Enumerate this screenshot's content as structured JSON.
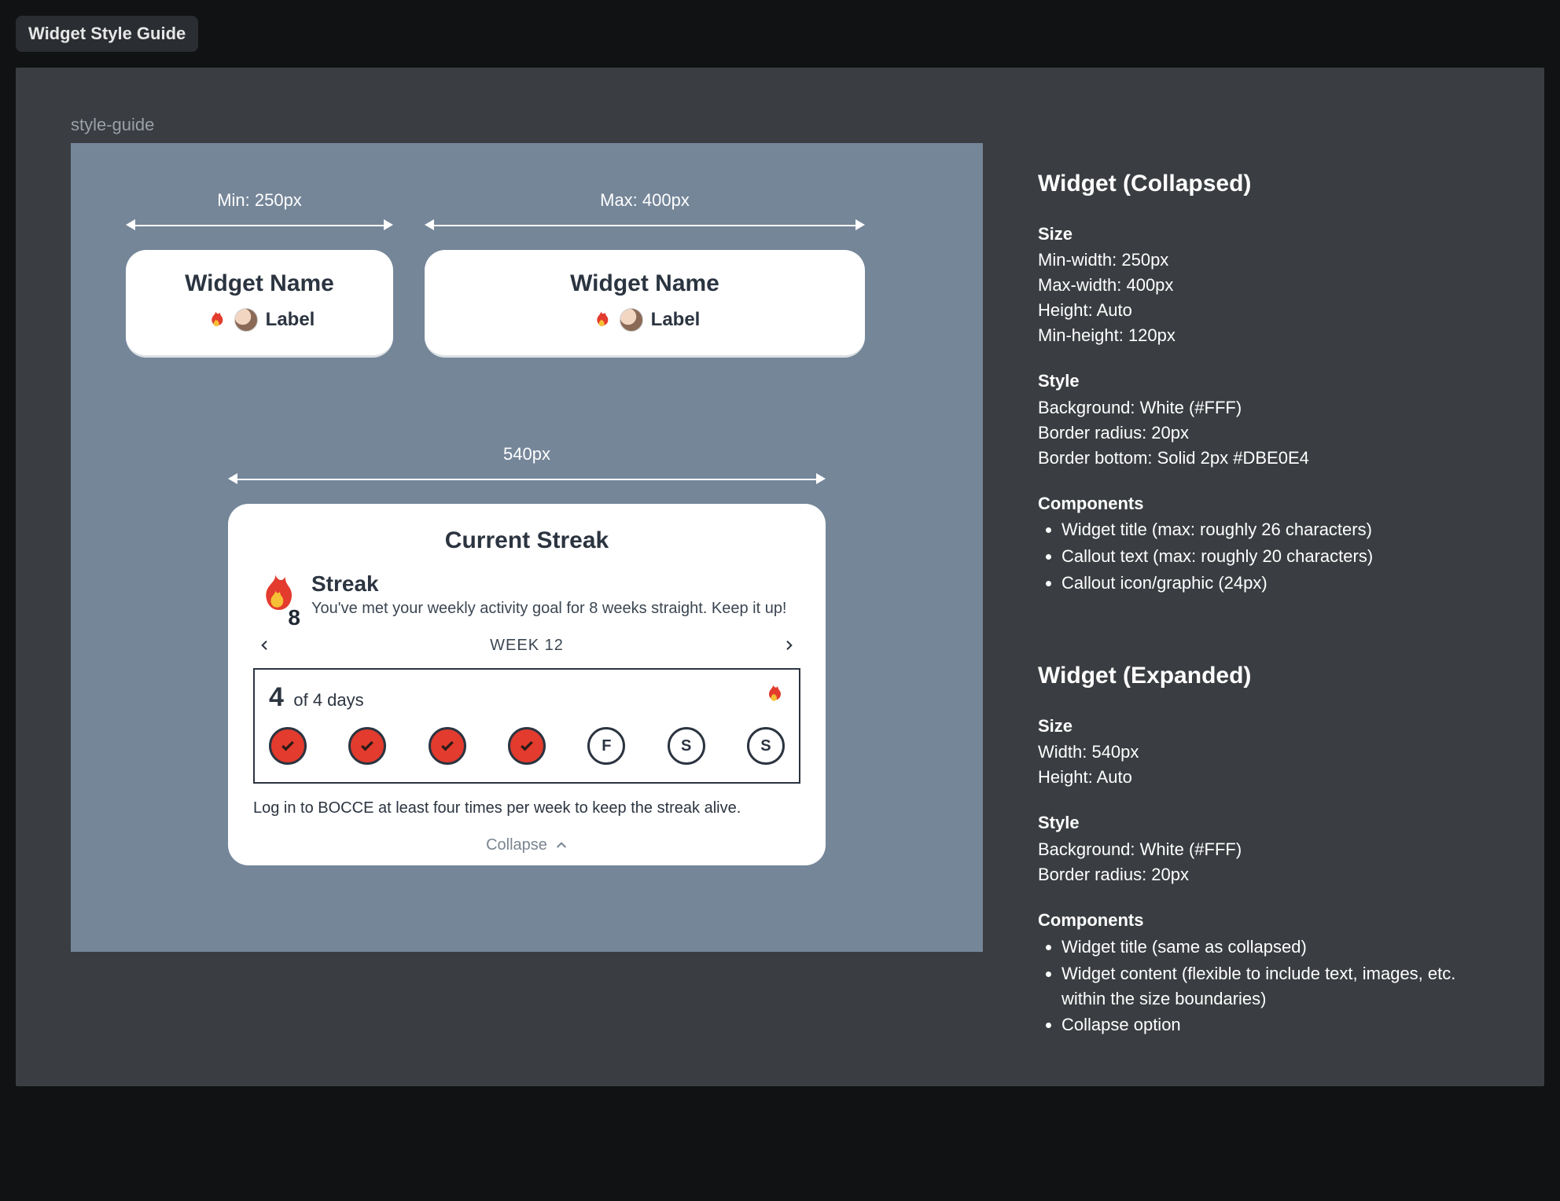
{
  "page_title": "Widget Style Guide",
  "canvas_label": "style-guide",
  "dimensions": {
    "min_label": "Min: 250px",
    "max_label": "Max: 400px",
    "expanded_label": "540px"
  },
  "collapsed_widget": {
    "title": "Widget Name",
    "callout_label": "Label"
  },
  "expanded_widget": {
    "title": "Current Streak",
    "streak_heading": "Streak",
    "streak_number": "8",
    "streak_sub": "You've met your weekly activity goal for 8 weeks straight. Keep it up!",
    "week_label": "WEEK 12",
    "count": "4",
    "of_label": "of 4 days",
    "days": [
      "done",
      "done",
      "done",
      "done",
      "F",
      "S",
      "S"
    ],
    "hint": "Log in to BOCCE at least four times per week to keep the streak alive.",
    "collapse_label": "Collapse"
  },
  "spec": {
    "collapsed": {
      "heading": "Widget (Collapsed)",
      "size_h": "Size",
      "size_lines": [
        "Min-width: 250px",
        "Max-width: 400px",
        "Height: Auto",
        "Min-height: 120px"
      ],
      "style_h": "Style",
      "style_lines": [
        "Background: White (#FFF)",
        "Border radius: 20px",
        "Border bottom: Solid 2px #DBE0E4"
      ],
      "components_h": "Components",
      "components": [
        "Widget title (max: roughly 26 characters)",
        "Callout text (max: roughly 20 characters)",
        "Callout icon/graphic (24px)"
      ]
    },
    "expanded": {
      "heading": "Widget (Expanded)",
      "size_h": "Size",
      "size_lines": [
        "Width: 540px",
        "Height:  Auto"
      ],
      "style_h": "Style",
      "style_lines": [
        "Background: White (#FFF)",
        "Border radius: 20px"
      ],
      "components_h": "Components",
      "components": [
        "Widget title (same as collapsed)",
        "Widget content (flexible to include text, images, etc. within the size boundaries)",
        "Collapse option"
      ]
    }
  }
}
